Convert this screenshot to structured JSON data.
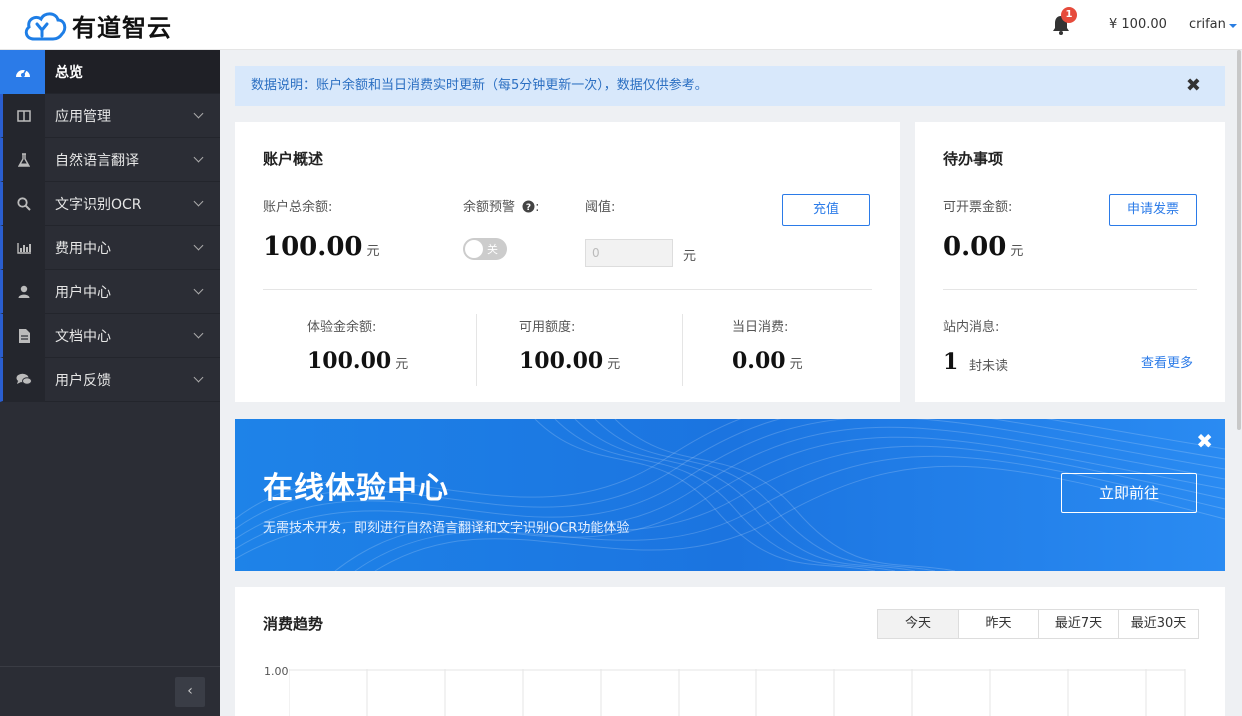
{
  "header": {
    "brand": "有道智云",
    "notification_count": "1",
    "balance": "¥ 100.00",
    "username": "crifan"
  },
  "sidebar": {
    "items": [
      {
        "label": "总览",
        "icon": "dashboard-icon",
        "active": true
      },
      {
        "label": "应用管理",
        "icon": "columns-icon"
      },
      {
        "label": "自然语言翻译",
        "icon": "flask-icon"
      },
      {
        "label": "文字识别OCR",
        "icon": "search-icon"
      },
      {
        "label": "费用中心",
        "icon": "bar-chart-icon"
      },
      {
        "label": "用户中心",
        "icon": "user-icon"
      },
      {
        "label": "文档中心",
        "icon": "file-icon"
      },
      {
        "label": "用户反馈",
        "icon": "comments-icon"
      }
    ],
    "collapse_label": "‹"
  },
  "notice": {
    "text": "数据说明：账户余额和当日消费实时更新（每5分钟更新一次），数据仅供参考。",
    "close": "✖"
  },
  "account": {
    "title": "账户概述",
    "total_balance_label": "账户总余额:",
    "total_balance_value": "100.00",
    "unit": "元",
    "alert_label": "余额预警",
    "alert_colon": ":",
    "toggle_label": "关",
    "threshold_label": "阈值:",
    "threshold_placeholder": "0",
    "threshold_unit": "元",
    "recharge_button": "充值",
    "trial_label": "体验金余额:",
    "trial_value": "100.00",
    "available_label": "可用额度:",
    "available_value": "100.00",
    "daily_label": "当日消费:",
    "daily_value": "0.00"
  },
  "todo": {
    "title": "待办事项",
    "invoice_label": "可开票金额:",
    "invoice_value": "0.00",
    "unit": "元",
    "invoice_button": "申请发票",
    "messages_label": "站内消息:",
    "messages_count": "1",
    "messages_suffix": "封未读",
    "more_link": "查看更多"
  },
  "banner": {
    "title": "在线体验中心",
    "subtitle": "无需技术开发，即刻进行自然语言翻译和文字识别OCR功能体验",
    "button": "立即前往",
    "close": "✖"
  },
  "trend": {
    "title": "消费趋势",
    "tabs": [
      "今天",
      "昨天",
      "最近7天",
      "最近30天"
    ],
    "ylabel_top": "1.00"
  },
  "colors": {
    "accent": "#2b7be8",
    "sidebar_bg": "#2b2d35",
    "notice_bg": "#d8e8fb",
    "badge": "#e64b3c"
  }
}
